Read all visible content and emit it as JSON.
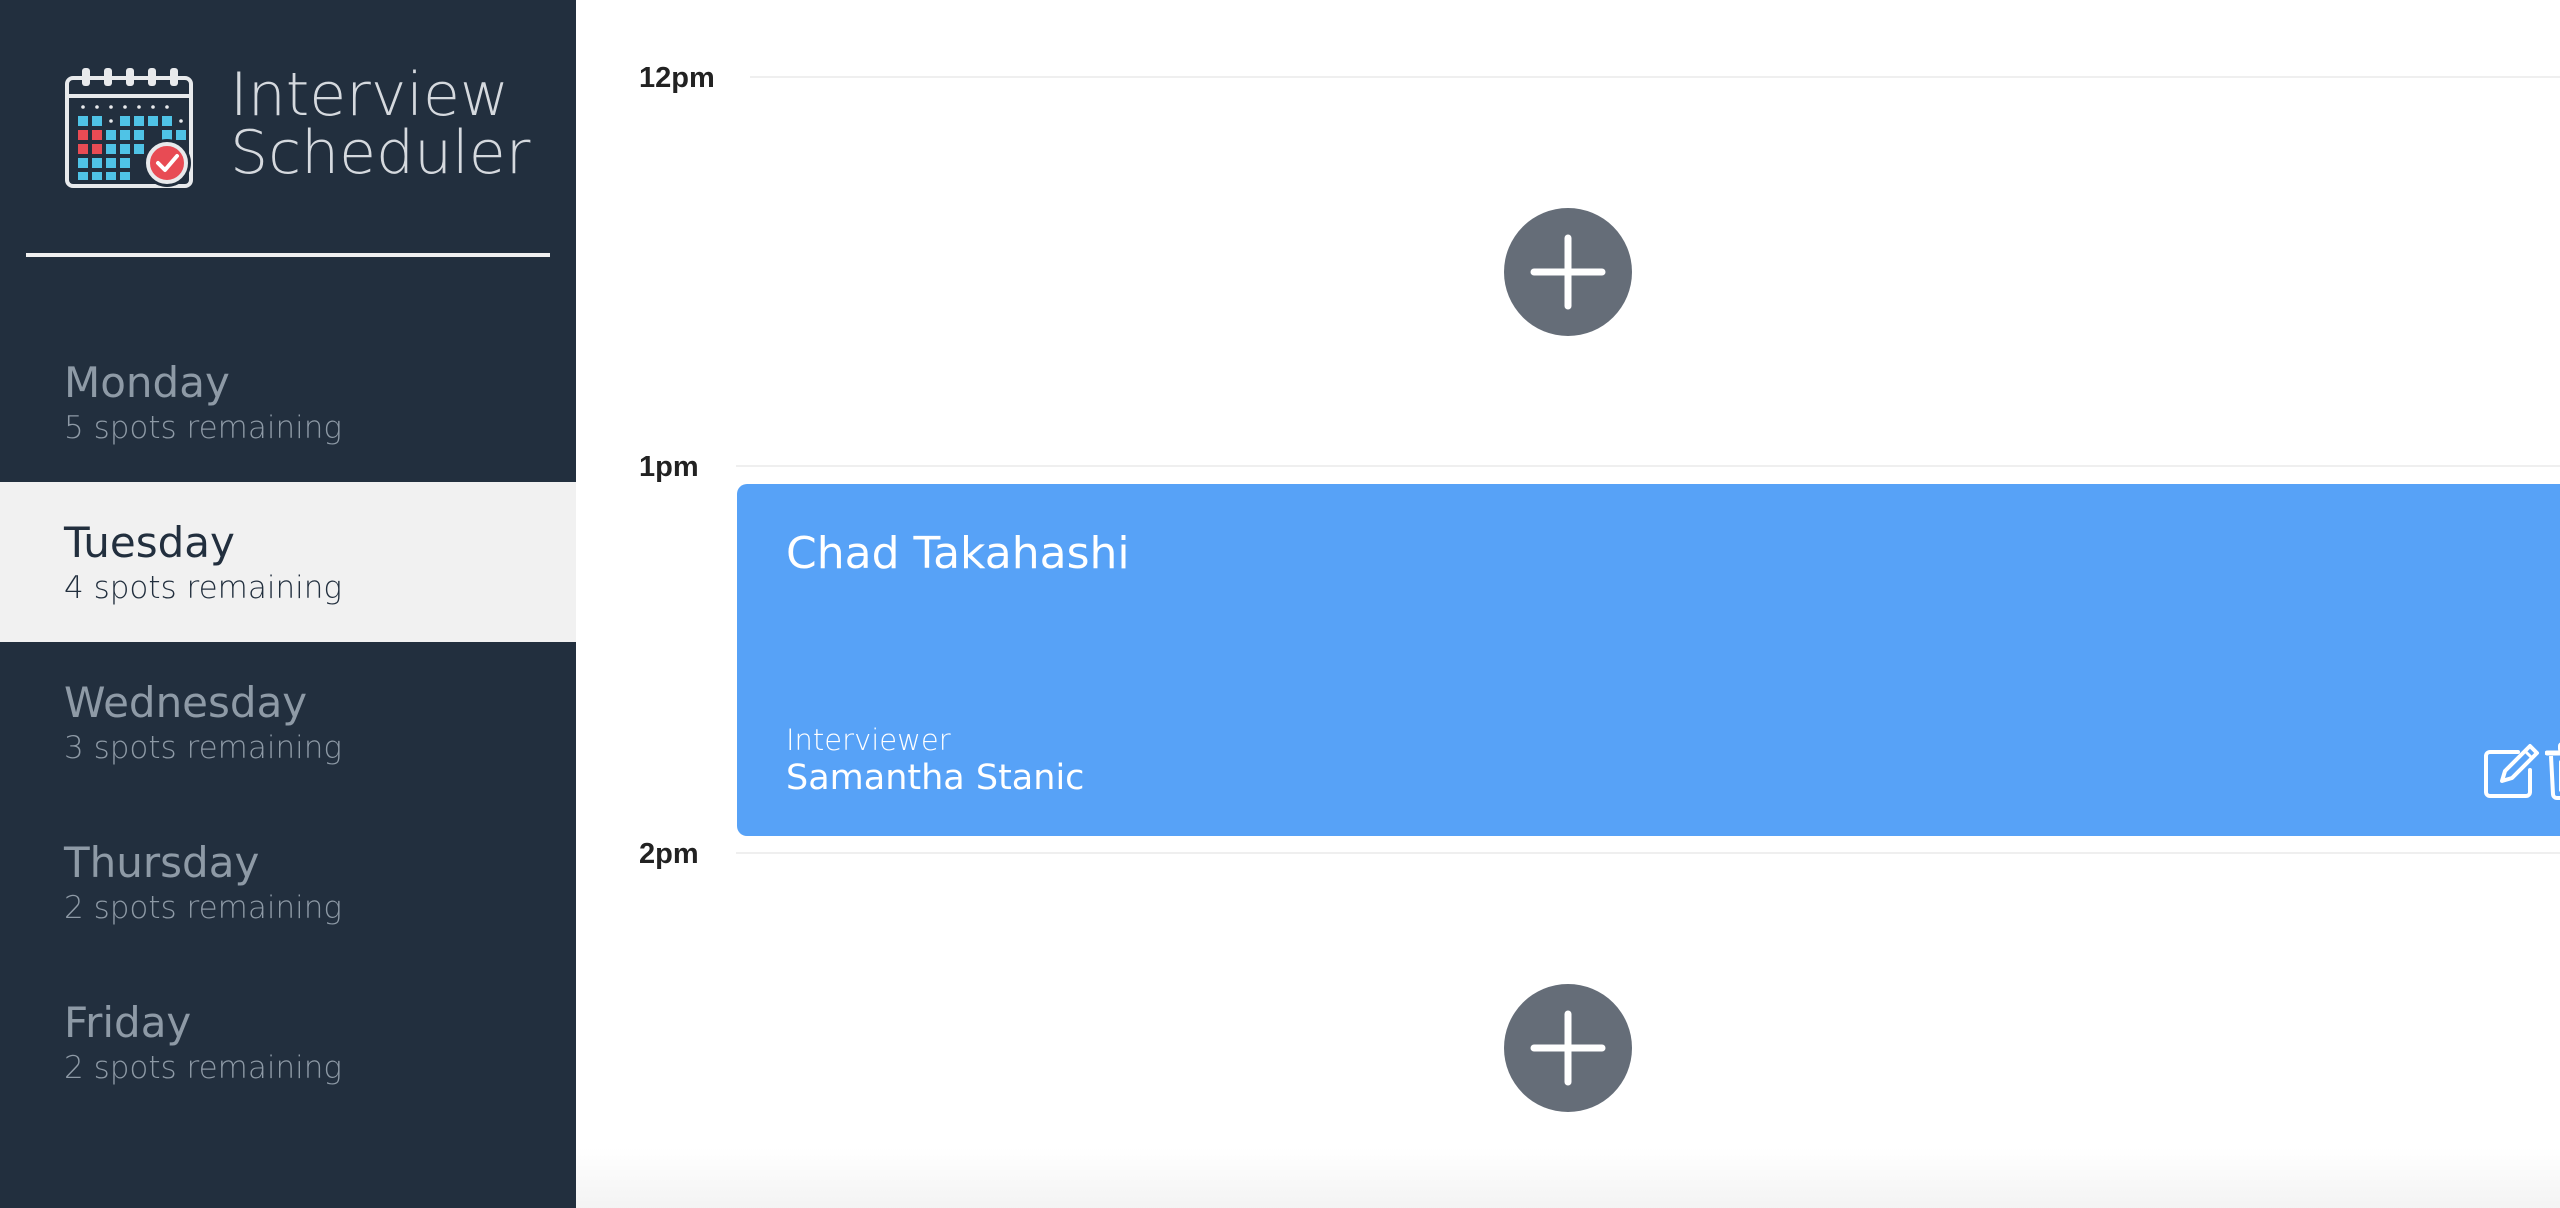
{
  "app": {
    "title_line1": "Interview",
    "title_line2": "Scheduler",
    "logo_icon": "calendar-check-icon"
  },
  "days": [
    {
      "name": "Monday",
      "spots": "5 spots remaining",
      "selected": false
    },
    {
      "name": "Tuesday",
      "spots": "4 spots remaining",
      "selected": true
    },
    {
      "name": "Wednesday",
      "spots": "3 spots remaining",
      "selected": false
    },
    {
      "name": "Thursday",
      "spots": "2 spots remaining",
      "selected": false
    },
    {
      "name": "Friday",
      "spots": "2 spots remaining",
      "selected": false
    }
  ],
  "schedule": {
    "times": [
      "12pm",
      "1pm",
      "2pm"
    ],
    "add_icon": "plus-icon",
    "appointment": {
      "student": "Chad Takahashi",
      "interviewer_label": "Interviewer",
      "interviewer": "Samantha Stanic",
      "edit_icon": "edit-icon",
      "delete_icon": "trash-icon"
    }
  },
  "colors": {
    "sidebar_bg": "#222f3e",
    "selected_day_bg": "#f1f1f1",
    "card_bg": "#57a2f7",
    "add_button_bg": "#656d78"
  }
}
